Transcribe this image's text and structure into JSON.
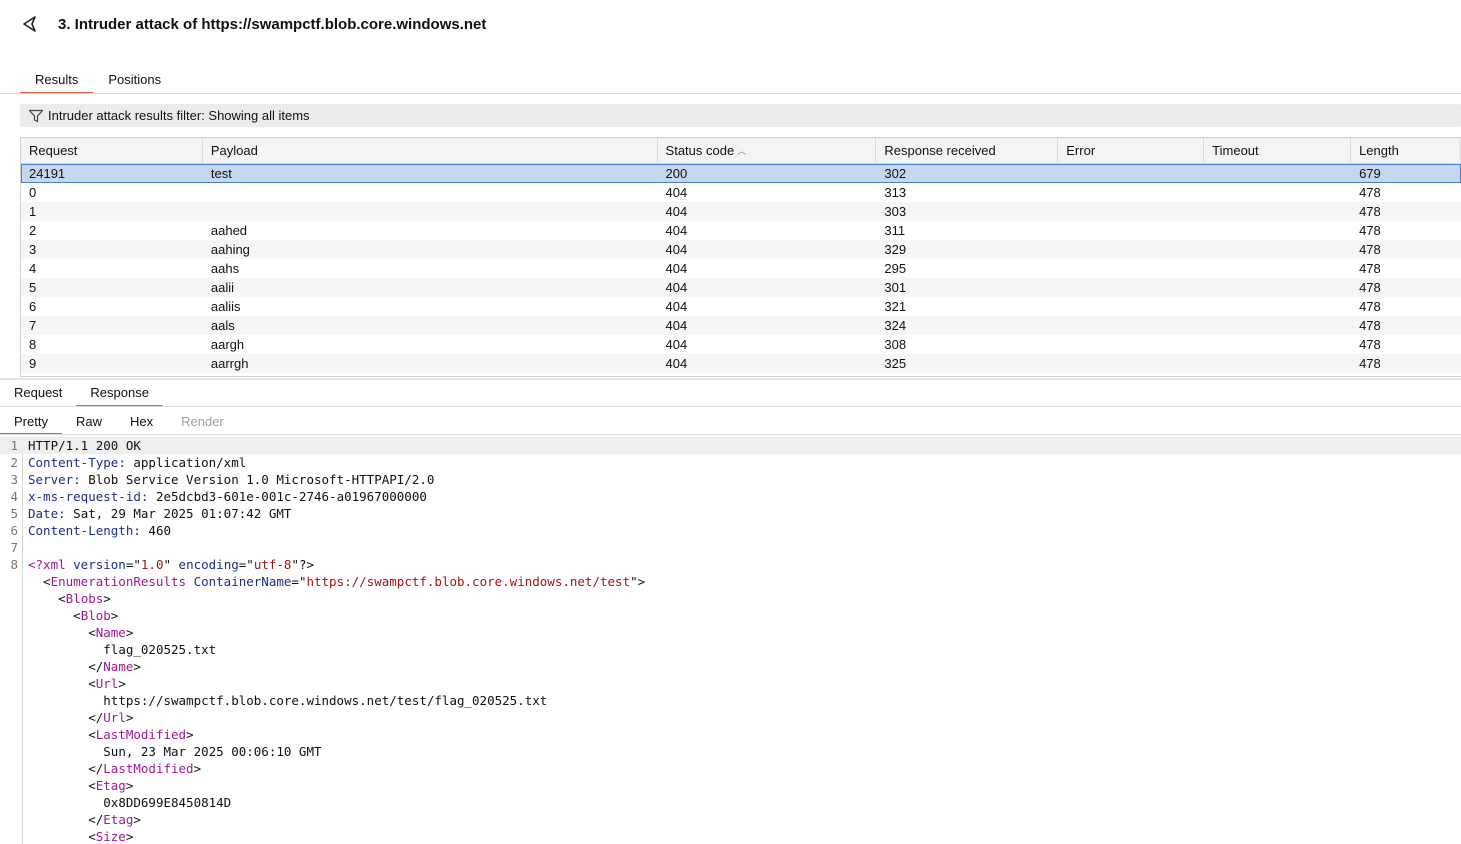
{
  "window": {
    "title": "3. Intruder attack of https://swampctf.blob.core.windows.net",
    "back_icon": "back-arrow-icon"
  },
  "top_tabs": [
    {
      "label": "Results",
      "active": true
    },
    {
      "label": "Positions",
      "active": false
    }
  ],
  "filter": {
    "icon": "funnel-filter-icon",
    "text": "Intruder attack results filter: Showing all items"
  },
  "results_table": {
    "columns": [
      "Request",
      "Payload",
      "Status code",
      "Response received",
      "Error",
      "Timeout",
      "Length"
    ],
    "sorted_column": "Status code",
    "sort_direction": "ascending",
    "rows": [
      {
        "request": "24191",
        "payload": "test",
        "status": "200",
        "received": "302",
        "error": "",
        "timeout": "",
        "length": "679",
        "selected": true
      },
      {
        "request": "0",
        "payload": "",
        "status": "404",
        "received": "313",
        "error": "",
        "timeout": "",
        "length": "478"
      },
      {
        "request": "1",
        "payload": "",
        "status": "404",
        "received": "303",
        "error": "",
        "timeout": "",
        "length": "478"
      },
      {
        "request": "2",
        "payload": "aahed",
        "status": "404",
        "received": "311",
        "error": "",
        "timeout": "",
        "length": "478"
      },
      {
        "request": "3",
        "payload": "aahing",
        "status": "404",
        "received": "329",
        "error": "",
        "timeout": "",
        "length": "478"
      },
      {
        "request": "4",
        "payload": "aahs",
        "status": "404",
        "received": "295",
        "error": "",
        "timeout": "",
        "length": "478"
      },
      {
        "request": "5",
        "payload": "aalii",
        "status": "404",
        "received": "301",
        "error": "",
        "timeout": "",
        "length": "478"
      },
      {
        "request": "6",
        "payload": "aaliis",
        "status": "404",
        "received": "321",
        "error": "",
        "timeout": "",
        "length": "478"
      },
      {
        "request": "7",
        "payload": "aals",
        "status": "404",
        "received": "324",
        "error": "",
        "timeout": "",
        "length": "478"
      },
      {
        "request": "8",
        "payload": "aargh",
        "status": "404",
        "received": "308",
        "error": "",
        "timeout": "",
        "length": "478"
      },
      {
        "request": "9",
        "payload": "aarrgh",
        "status": "404",
        "received": "325",
        "error": "",
        "timeout": "",
        "length": "478"
      }
    ]
  },
  "message_tabs": [
    {
      "label": "Request",
      "active": false
    },
    {
      "label": "Response",
      "active": true
    }
  ],
  "view_tabs": [
    {
      "label": "Pretty",
      "active": true,
      "disabled": false
    },
    {
      "label": "Raw",
      "active": false,
      "disabled": false
    },
    {
      "label": "Hex",
      "active": false,
      "disabled": false
    },
    {
      "label": "Render",
      "active": false,
      "disabled": true
    }
  ],
  "response": {
    "status_line": "HTTP/1.1 200 OK",
    "headers": [
      {
        "name": "Content-Type",
        "value": "application/xml"
      },
      {
        "name": "Server",
        "value": "Blob Service Version 1.0 Microsoft-HTTPAPI/2.0"
      },
      {
        "name": "x-ms-request-id",
        "value": "2e5dcbd3-601e-001c-2746-a01967000000"
      },
      {
        "name": "Date",
        "value": "Sat, 29 Mar 2025 01:07:42 GMT"
      },
      {
        "name": "Content-Length",
        "value": "460"
      }
    ],
    "xml_decl": {
      "version": "1.0",
      "encoding": "utf-8"
    },
    "container_name": "https://swampctf.blob.core.windows.net/test",
    "blob": {
      "name": "flag_020525.txt",
      "url": "https://swampctf.blob.core.windows.net/test/flag_020525.txt",
      "last_modified": "Sun, 23 Mar 2025 00:06:10 GMT",
      "etag": "0x8DD699E8450814D"
    },
    "line_numbers": [
      "1",
      "2",
      "3",
      "4",
      "5",
      "6",
      "7",
      "8"
    ]
  }
}
